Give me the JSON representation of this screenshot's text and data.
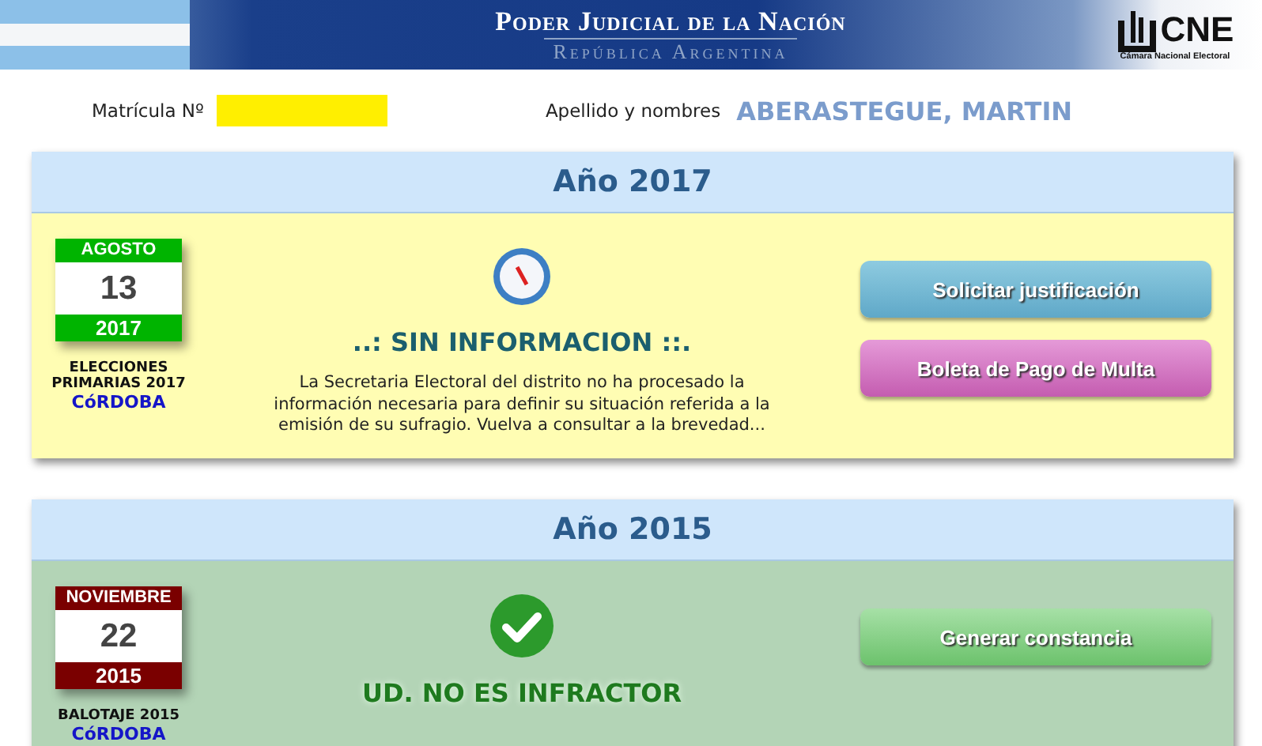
{
  "header": {
    "title": "Poder Judicial de la Nación",
    "subtitle": "República Argentina",
    "logo_text": "CNE",
    "logo_caption": "Cámara Nacional Electoral"
  },
  "person": {
    "matricula_label": "Matrícula Nº",
    "name_label": "Apellido y nombres",
    "name": "ABERASTEGUE, MARTIN"
  },
  "years": [
    {
      "title": "Año 2017",
      "kind": "pending",
      "month": "AGOSTO",
      "day": "13",
      "year": "2017",
      "color": "#00b400",
      "election": "ELECCIONES PRIMARIAS 2017",
      "district": "CóRDOBA",
      "message": "..: SIN INFORMACION ::.",
      "detail": "La Secretaria Electoral del distrito no ha procesado la información necesaria para definir su situación referida a la emisión de su sufragio. Vuelva a consultar a la brevedad...",
      "buttons": [
        {
          "label": "Solicitar justificación",
          "kind": "blue"
        },
        {
          "label": "Boleta de Pago de Multa",
          "kind": "pink"
        }
      ]
    },
    {
      "title": "Año 2015",
      "kind": "ok",
      "month": "NOVIEMBRE",
      "day": "22",
      "year": "2015",
      "color": "#7a0000",
      "election": "BALOTAJE 2015",
      "district": "CóRDOBA",
      "message": "UD. NO ES INFRACTOR",
      "buttons": [
        {
          "label": "Generar constancia",
          "kind": "green"
        }
      ]
    }
  ]
}
